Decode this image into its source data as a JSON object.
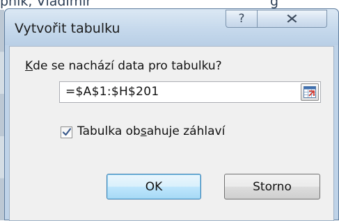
{
  "background": {
    "partial_text": "pník, Vladimír",
    "partial_cell": "g"
  },
  "dialog": {
    "title": "Vytvořit tabulku",
    "help_glyph": "?",
    "close_glyph": "✕",
    "question_prefix_underlined": "K",
    "question_rest": "de se nachází data pro tabulku?",
    "range_value": "=$A$1:$H$201",
    "range_collapse_icon": "collapse-dialog-icon",
    "checkbox_checked": true,
    "checkbox_label_part1": "Tabulka ob",
    "checkbox_label_underlined": "s",
    "checkbox_label_part2": "ahuje záhlaví",
    "ok_label": "OK",
    "cancel_label": "Storno"
  },
  "colors": {
    "frame": "#bfd3e8",
    "client": "#f0f0f0",
    "ok_border": "#3c7fb1"
  }
}
